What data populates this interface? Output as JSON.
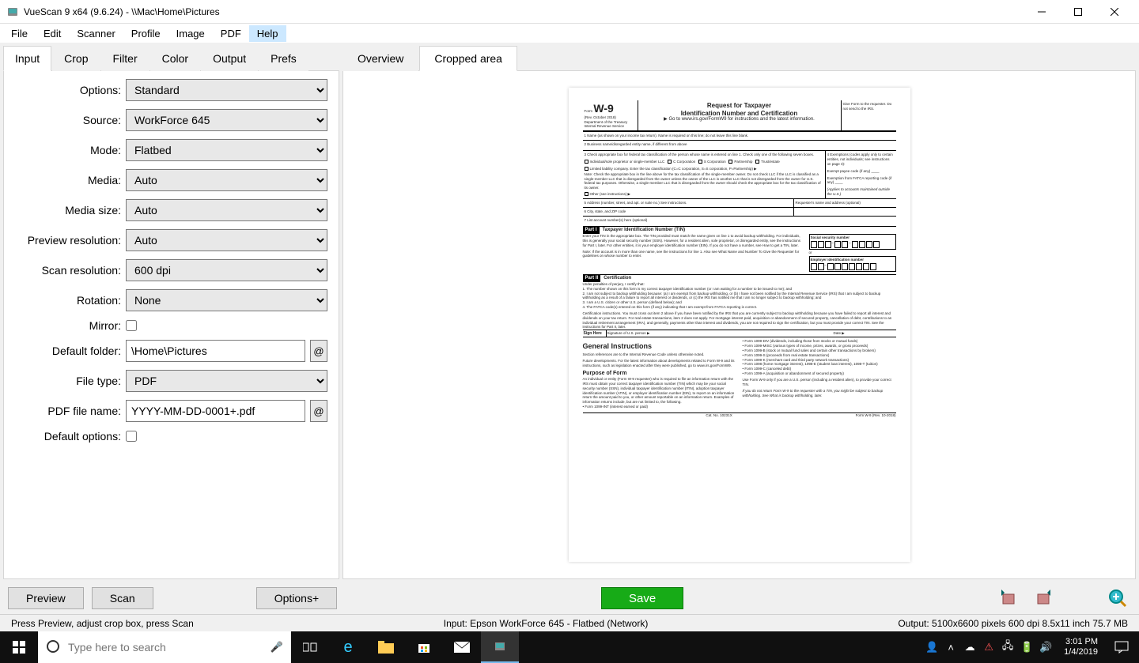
{
  "window": {
    "title": "VueScan 9 x64 (9.6.24) - \\\\Mac\\Home\\Pictures"
  },
  "menu": [
    "File",
    "Edit",
    "Scanner",
    "Profile",
    "Image",
    "PDF",
    "Help"
  ],
  "leftTabs": [
    "Input",
    "Crop",
    "Filter",
    "Color",
    "Output",
    "Prefs"
  ],
  "activeLeftTab": 0,
  "rightTabs": [
    "Overview",
    "Cropped area"
  ],
  "activeRightTab": 1,
  "fields": {
    "options": {
      "label": "Options:",
      "value": "Standard"
    },
    "source": {
      "label": "Source:",
      "value": "WorkForce 645"
    },
    "mode": {
      "label": "Mode:",
      "value": "Flatbed"
    },
    "media": {
      "label": "Media:",
      "value": "Auto"
    },
    "mediaSize": {
      "label": "Media size:",
      "value": "Auto"
    },
    "previewRes": {
      "label": "Preview resolution:",
      "value": "Auto"
    },
    "scanRes": {
      "label": "Scan resolution:",
      "value": "600 dpi"
    },
    "rotation": {
      "label": "Rotation:",
      "value": "None"
    },
    "mirror": {
      "label": "Mirror:"
    },
    "defaultFolder": {
      "label": "Default folder:",
      "value": "\\Home\\Pictures"
    },
    "fileType": {
      "label": "File type:",
      "value": "PDF"
    },
    "pdfFileName": {
      "label": "PDF file name:",
      "value": "YYYY-MM-DD-0001+.pdf"
    },
    "defaultOptions": {
      "label": "Default options:"
    }
  },
  "buttons": {
    "preview": "Preview",
    "scan": "Scan",
    "optionsPlus": "Options+",
    "save": "Save"
  },
  "status": {
    "left": "Press Preview, adjust crop box, press Scan",
    "center": "Input: Epson WorkForce 645 - Flatbed (Network)",
    "right": "Output: 5100x6600 pixels 600 dpi 8.5x11 inch 75.7 MB"
  },
  "taskbar": {
    "searchPlaceholder": "Type here to search",
    "time": "3:01 PM",
    "date": "1/4/2019"
  },
  "doc": {
    "formNo": "W-9",
    "formPrefix": "Form",
    "rev": "(Rev. October 2018)",
    "dept": "Department of the Treasury\nInternal Revenue Service",
    "title1": "Request for Taxpayer",
    "title2": "Identification Number and Certification",
    "goto": "▶ Go to www.irs.gov/FormW9 for instructions and the latest information.",
    "give": "Give Form to the requester. Do not send to the IRS.",
    "line1": "1  Name (as shown on your income tax return). Name is required on this line; do not leave this line blank.",
    "line2": "2  Business name/disregarded entity name, if different from above",
    "line3": "3  Check appropriate box for federal tax classification of the person whose name is entered on line 1. Check only one of the following seven boxes.",
    "cbs": [
      "Individual/sole proprietor or single-member LLC",
      "C Corporation",
      "S Corporation",
      "Partnership",
      "Trust/estate"
    ],
    "llc": "Limited liability company. Enter the tax classification (C=C corporation, S=S corporation, P=Partnership) ▶",
    "note": "Note: Check the appropriate box in the line above for the tax classification of the single-member owner. Do not check LLC if the LLC is classified as a single-member LLC that is disregarded from the owner unless the owner of the LLC is another LLC that is not disregarded from the owner for U.S. federal tax purposes. Otherwise, a single-member LLC that is disregarded from the owner should check the appropriate box for the tax classification of its owner.",
    "other": "Other (see instructions) ▶",
    "ex4": "4  Exemptions (codes apply only to certain entities, not individuals; see instructions on page 3):",
    "ex4a": "Exempt payee code (if any) ____",
    "ex4b": "Exemption from FATCA reporting code (if any) ____",
    "ex4c": "(Applies to accounts maintained outside the U.S.)",
    "line5": "5  Address (number, street, and apt. or suite no.) See instructions.",
    "line5r": "Requester's name and address (optional)",
    "line6": "6  City, state, and ZIP code",
    "line7": "7  List account number(s) here (optional)",
    "partI": "Part I",
    "partI_t": "Taxpayer Identification Number (TIN)",
    "partI_txt": "Enter your TIN in the appropriate box. The TIN provided must match the name given on line 1 to avoid backup withholding. For individuals, this is generally your social security number (SSN). However, for a resident alien, sole proprietor, or disregarded entity, see the instructions for Part I, later. For other entities, it is your employer identification number (EIN). If you do not have a number, see How to get a TIN, later.",
    "partI_note": "Note: If the account is in more than one name, see the instructions for line 1. Also see What Name and Number To Give the Requester for guidelines on whose number to enter.",
    "ssn": "Social security number",
    "or": "or",
    "ein": "Employer identification number",
    "partII": "Part II",
    "partII_t": "Certification",
    "cert_lead": "Under penalties of perjury, I certify that:",
    "cert1": "1. The number shown on this form is my correct taxpayer identification number (or I am waiting for a number to be issued to me); and",
    "cert2": "2. I am not subject to backup withholding because: (a) I am exempt from backup withholding, or (b) I have not been notified by the Internal Revenue Service (IRS) that I am subject to backup withholding as a result of a failure to report all interest or dividends, or (c) the IRS has notified me that I am no longer subject to backup withholding; and",
    "cert3": "3. I am a U.S. citizen or other U.S. person (defined below); and",
    "cert4": "4. The FATCA code(s) entered on this form (if any) indicating that I am exempt from FATCA reporting is correct.",
    "cert_inst": "Certification instructions. You must cross out item 2 above if you have been notified by the IRS that you are currently subject to backup withholding because you have failed to report all interest and dividends on your tax return. For real estate transactions, item 2 does not apply. For mortgage interest paid, acquisition or abandonment of secured property, cancellation of debt, contributions to an individual retirement arrangement (IRA), and generally, payments other than interest and dividends, you are not required to sign the certification, but you must provide your correct TIN. See the instructions for Part II, later.",
    "sign": "Sign Here",
    "sig": "Signature of U.S. person ▶",
    "date": "Date ▶",
    "gi": "General Instructions",
    "gi1": "Section references are to the Internal Revenue Code unless otherwise noted.",
    "gi2": "Future developments. For the latest information about developments related to Form W-9 and its instructions, such as legislation enacted after they were published, go to www.irs.gov/FormW9.",
    "pf": "Purpose of Form",
    "pf1": "An individual or entity (Form W-9 requester) who is required to file an information return with the IRS must obtain your correct taxpayer identification number (TIN) which may be your social security number (SSN), individual taxpayer identification number (ITIN), adoption taxpayer identification number (ATIN), or employer identification number (EIN), to report on an information return the amount paid to you, or other amount reportable on an information return. Examples of information returns include, but are not limited to, the following.",
    "pf2": "• Form 1099-INT (interest earned or paid)",
    "rc": [
      "• Form 1099-DIV (dividends, including those from stocks or mutual funds)",
      "• Form 1099-MISC (various types of income, prizes, awards, or gross proceeds)",
      "• Form 1099-B (stock or mutual fund sales and certain other transactions by brokers)",
      "• Form 1099-S (proceeds from real estate transactions)",
      "• Form 1099-K (merchant card and third party network transactions)",
      "• Form 1098 (home mortgage interest), 1098-E (student loan interest), 1098-T (tuition)",
      "• Form 1099-C (canceled debt)",
      "• Form 1099-A (acquisition or abandonment of secured property)",
      "Use Form W-9 only if you are a U.S. person (including a resident alien), to provide your correct TIN.",
      "If you do not return Form W-9 to the requester with a TIN, you might be subject to backup withholding. See What is backup withholding, later."
    ],
    "cat": "Cat. No. 10231X",
    "formfoot": "Form W-9 (Rev. 10-2018)"
  }
}
